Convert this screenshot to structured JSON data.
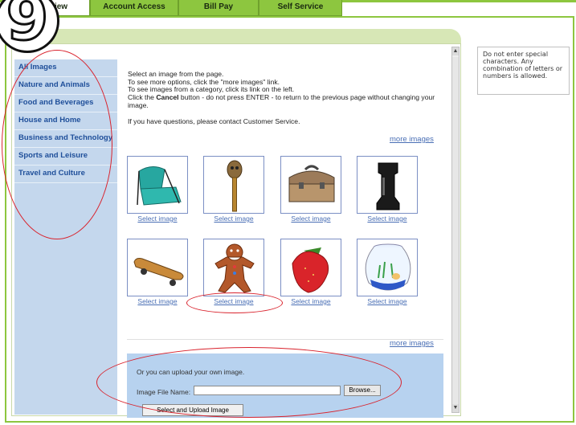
{
  "step_number": "9",
  "tabs": [
    {
      "label": "iew"
    },
    {
      "label": "Account Access"
    },
    {
      "label": "Bill Pay"
    },
    {
      "label": "Self Service"
    }
  ],
  "sidebar": {
    "items": [
      {
        "label": "All Images"
      },
      {
        "label": "Nature and Animals"
      },
      {
        "label": "Food and Beverages"
      },
      {
        "label": "House and Home"
      },
      {
        "label": "Business and Technology"
      },
      {
        "label": "Sports and Leisure"
      },
      {
        "label": "Travel and Culture"
      }
    ]
  },
  "instructions": {
    "line1": "Select an image from the page.",
    "line2": "To see more options, click the \"more images\" link.",
    "line3": "To see images from a category, click its link on the left.",
    "line4_pre": "Click the ",
    "line4_bold": "Cancel",
    "line4_post": " button - do not press ENTER - to return to the previous page without changing your image.",
    "line5": "If you have questions, please contact Customer Service."
  },
  "more_images_top": "more images",
  "more_images_bottom": "more images",
  "images": [
    {
      "name": "folding-chair-icon",
      "select_label": "Select image"
    },
    {
      "name": "tiki-stick-icon",
      "select_label": "Select image"
    },
    {
      "name": "lunchbox-icon",
      "select_label": "Select image"
    },
    {
      "name": "chess-rook-icon",
      "select_label": "Select image"
    },
    {
      "name": "skateboard-icon",
      "select_label": "Select image"
    },
    {
      "name": "gingerbread-man-icon",
      "select_label": "Select image"
    },
    {
      "name": "strawberry-icon",
      "select_label": "Select image"
    },
    {
      "name": "fishbowl-icon",
      "select_label": "Select image"
    }
  ],
  "upload": {
    "intro": "Or you can upload your own image.",
    "file_label": "Image File Name:",
    "file_value": "",
    "browse_label": "Browse...",
    "submit_label": "Select and Upload Image"
  },
  "note": "Do not enter special characters. Any combination of letters or numbers is allowed.",
  "colors": {
    "brand_green": "#8dc63f",
    "sidebar_blue": "#c4d7ed",
    "link_blue": "#4a6fb5",
    "annotation_red": "#d9232d"
  }
}
